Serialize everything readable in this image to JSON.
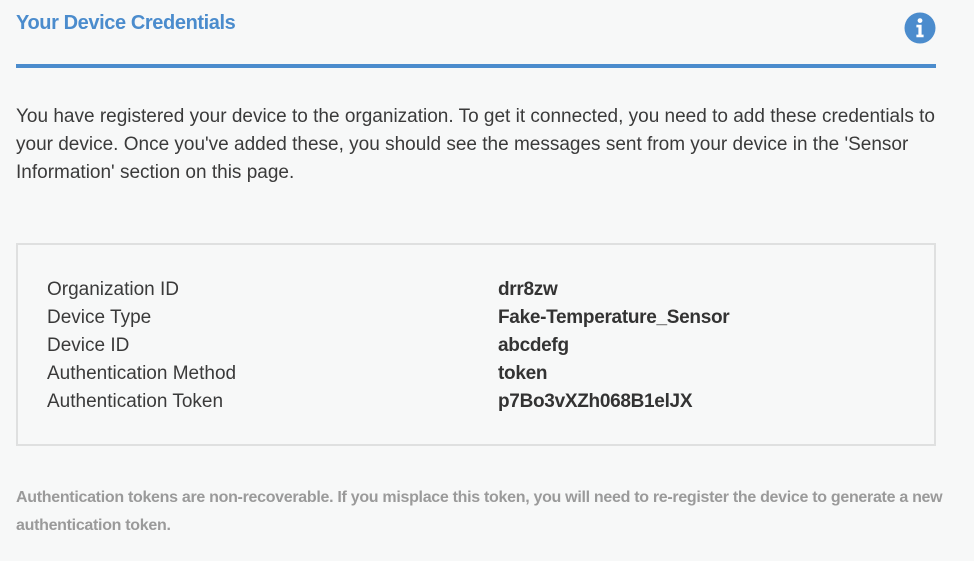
{
  "header": {
    "title": "Your Device Credentials",
    "info_icon": "info-circle-icon",
    "accent_color": "#4b8ccd"
  },
  "intro": "You have registered your device to the organization. To get it connected, you need to add these credentials to your device. Once you've added these, you should see the messages sent from your device in the 'Sensor Information' section on this page.",
  "credentials": [
    {
      "label": "Organization ID",
      "value": "drr8zw"
    },
    {
      "label": "Device Type",
      "value": "Fake-Temperature_Sensor"
    },
    {
      "label": "Device ID",
      "value": "abcdefg"
    },
    {
      "label": "Authentication Method",
      "value": "token"
    },
    {
      "label": "Authentication Token",
      "value": "p7Bo3vXZh068B1elJX"
    }
  ],
  "note": "Authentication tokens are non-recoverable. If you misplace this token, you will need to re-register the device to generate a new authentication token."
}
